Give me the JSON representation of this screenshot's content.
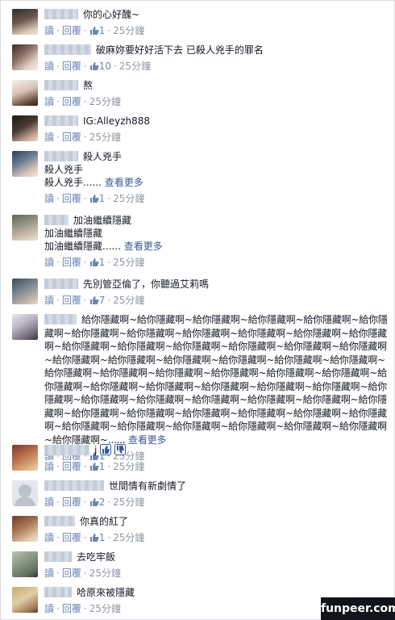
{
  "labels": {
    "reply": "讀",
    "respond": "回覆",
    "sep": "·"
  },
  "colors": {
    "link": "#3b5998",
    "meta": "#9197a3",
    "action": "#6d84b4"
  },
  "comments": [
    {
      "text": "你的心好醜~",
      "likes": "1",
      "time": "25分鐘"
    },
    {
      "text": "破麻妳要好好活下去 已殺人兇手的罪名",
      "likes": "10",
      "time": "25分鐘"
    },
    {
      "text": "熬",
      "likes": "",
      "time": "25分鐘"
    },
    {
      "text": "IG:Alleyzh888",
      "likes": "",
      "time": "25分鐘"
    },
    {
      "text": "殺人兇手",
      "line2": "殺人兇手",
      "line3": "殺人兇手......",
      "more": "查看更多",
      "likes": "1",
      "time": "25分鐘"
    },
    {
      "text": "加油繼續隱藏",
      "line2": "加油繼續隱藏",
      "line3": "加油繼續隱藏......",
      "more": "查看更多",
      "likes": "1",
      "time": "25分鐘"
    },
    {
      "text": "先別管亞倫了，你聽過艾莉嗎",
      "likes": "7",
      "time": "25分鐘"
    },
    {
      "text": "給你隱藏啊~給你隱藏啊~給你隱藏啊~給你隱藏啊~給你隱藏啊~給你隱藏啊~給你隱藏啊~給你隱藏啊~給你隱藏啊~給你隱藏啊~給你隱藏啊~給你隱藏啊~給你隱藏啊~給你隱藏啊~給你隱藏啊~給你隱藏啊~給你隱藏啊~給你隱藏啊~給你隱藏啊~給你隱藏啊~給你隱藏啊~給你隱藏啊~給你隱藏啊~給你隱藏啊~給你隱藏啊~給你隱藏啊~給你隱藏啊~給你隱藏啊~給你隱藏啊~給你隱藏啊~給你隱藏啊~給你隱藏啊~給你隱藏啊~給你隱藏啊~給你隱藏啊~給你隱藏啊~給你隱藏啊~給你隱藏啊~給你隱藏啊~給你隱藏啊~給你隱藏啊~給你隱藏啊~給你隱藏啊~給你隱藏啊~給你隱藏啊~給你隱藏啊~給你隱藏啊~給你隱藏啊~給你隱藏啊~給你隱藏啊~給你隱藏啊~給你隱藏啊~給你隱藏啊~給你隱藏啊~給你隱藏啊~給你隱藏啊~......",
      "more": "查看更多",
      "likes": "1",
      "time": "25分鐘"
    },
    {
      "text": "j",
      "likes": "1",
      "time": "25分鐘"
    },
    {
      "text": "世間情有新劇情了",
      "likes": "2",
      "time": "25分鐘"
    },
    {
      "text": "你真的紅了",
      "likes": "1",
      "time": "25分鐘"
    },
    {
      "text": "去吃牢飯",
      "likes": "",
      "time": "25分鐘"
    },
    {
      "text": "哈原來被隱藏",
      "likes": "",
      "time": "25分鐘"
    }
  ],
  "watermark": "funpeer.com"
}
